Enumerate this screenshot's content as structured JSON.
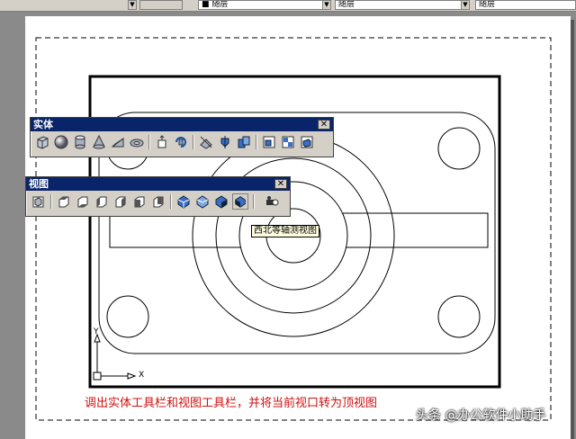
{
  "topbar": {
    "layer_combo": "■ 随层",
    "linetype_combo": "随层",
    "lineweight_combo": "随层"
  },
  "toolbars": {
    "solids": {
      "title": "实体",
      "close_glyph": "✕",
      "icons": [
        "box-icon",
        "sphere-icon",
        "cylinder-icon",
        "cone-icon",
        "wedge-icon",
        "torus-icon",
        "extrude-icon",
        "revolve-icon",
        "slice-icon",
        "section-icon",
        "interference-icon",
        "setup-drawing-icon",
        "setup-view-icon",
        "setup-profile-icon"
      ]
    },
    "view": {
      "title": "视图",
      "close_glyph": "✕",
      "icons": [
        "named-views-icon",
        "top-view-icon",
        "bottom-view-icon",
        "left-view-icon",
        "right-view-icon",
        "front-view-icon",
        "back-view-icon",
        "sw-isometric-icon",
        "se-isometric-icon",
        "ne-isometric-icon",
        "nw-isometric-icon",
        "camera-icon"
      ],
      "tooltip": "西北等轴测视图"
    }
  },
  "drawing": {
    "ucs_x_label": "X",
    "ucs_y_label": "Y"
  },
  "caption": "调出实体工具栏和视图工具栏，并将当前视口转为顶视图",
  "watermark": "头条 @办公软件小助手",
  "colors": {
    "title_bar": "#0a246a",
    "caption_red": "#d01010",
    "toolbar_face": "#d4d0c8",
    "tooltip_bg": "#ffffe1"
  }
}
